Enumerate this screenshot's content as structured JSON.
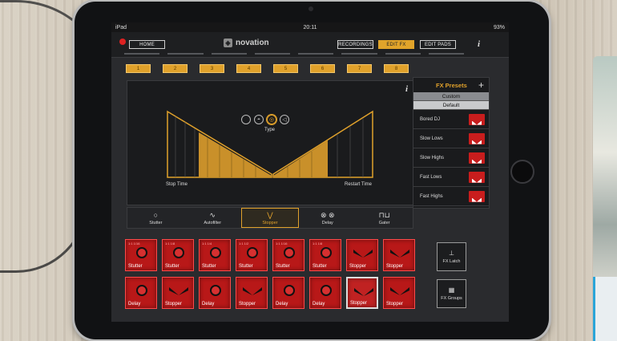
{
  "status": {
    "left": "iPad",
    "time": "20:11",
    "battery": "93%"
  },
  "topbar": {
    "home": "HOME",
    "brand": "novation",
    "recordings": "RECORDINGS",
    "edit_fx": "EDIT FX",
    "edit_pads": "EDIT PADS",
    "info": "i"
  },
  "pad_numbers": [
    "1",
    "2",
    "3",
    "4",
    "5",
    "6",
    "7",
    "8"
  ],
  "fx_editor": {
    "info": "i",
    "type_label": "Type",
    "stop_time": "Stop Time",
    "restart_time": "Restart Time",
    "type_options": [
      "blank-circle-icon",
      "half-circle-icon",
      "target-circle-icon",
      "speaker-icon"
    ],
    "type_selected_index": 2
  },
  "fx_tabs": [
    {
      "label": "Stutter",
      "icon": "○"
    },
    {
      "label": "Autofilter",
      "icon": "∿"
    },
    {
      "label": "Stopper",
      "icon": "⋁"
    },
    {
      "label": "Delay",
      "icon": "⊗ ⊗"
    },
    {
      "label": "Gater",
      "icon": "⊓⊔"
    }
  ],
  "fx_tab_selected": "Stopper",
  "presets": {
    "title": "FX Presets",
    "add": "+",
    "segments": [
      "Custom",
      "Default"
    ],
    "segment_selected": "Default",
    "items": [
      "Bored DJ",
      "Slow Lows",
      "Slow Highs",
      "Fast Lows",
      "Fast Highs"
    ]
  },
  "fx_pads": {
    "row1": [
      "Stutter",
      "Stutter",
      "Stutter",
      "Stutter",
      "Stutter",
      "Stutter",
      "Stopper",
      "Stopper"
    ],
    "row2": [
      "Delay",
      "Stopper",
      "Delay",
      "Stopper",
      "Delay",
      "Delay",
      "Stopper",
      "Stopper"
    ],
    "highlighted": {
      "row": 2,
      "col": 7
    }
  },
  "side_buttons": {
    "latch": "FX Latch",
    "groups": "FX Groups"
  },
  "colors": {
    "accent": "#e0a12b",
    "pad_red": "#b81818",
    "bg": "#2a2b2e"
  }
}
